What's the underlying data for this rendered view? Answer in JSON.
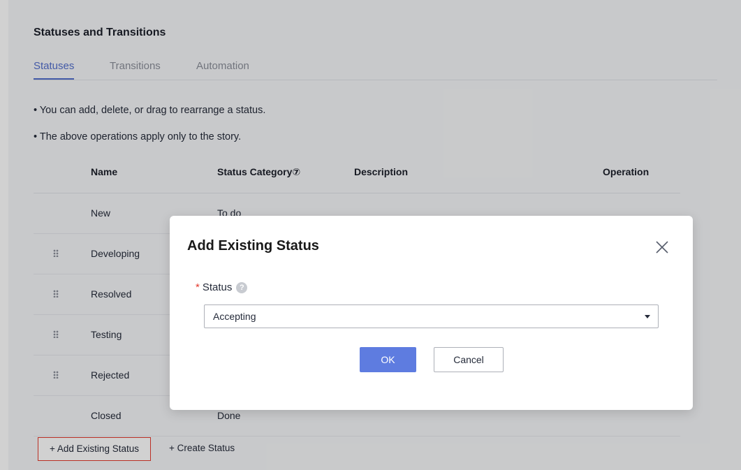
{
  "section": {
    "title": "Statuses and Transitions"
  },
  "tabs": [
    {
      "label": "Statuses",
      "active": true
    },
    {
      "label": "Transitions",
      "active": false
    },
    {
      "label": "Automation",
      "active": false
    }
  ],
  "notes": [
    "• You can add, delete, or drag to rearrange a status.",
    "• The above operations apply only to the story."
  ],
  "table": {
    "headers": {
      "name": "Name",
      "category": "Status Category⑦",
      "description": "Description",
      "operation": "Operation"
    },
    "rows": [
      {
        "name": "New",
        "category": "To do",
        "draggable": false
      },
      {
        "name": "Developing",
        "category": "",
        "draggable": true
      },
      {
        "name": "Resolved",
        "category": "",
        "draggable": true
      },
      {
        "name": "Testing",
        "category": "",
        "draggable": true
      },
      {
        "name": "Rejected",
        "category": "",
        "draggable": true
      },
      {
        "name": "Closed",
        "category": "Done",
        "draggable": false
      }
    ]
  },
  "actions": {
    "add_existing": "+ Add Existing Status",
    "create": "+ Create Status"
  },
  "dialog": {
    "title": "Add Existing Status",
    "field_label": "Status",
    "required_mark": "*",
    "help_glyph": "?",
    "selected_value": "Accepting",
    "ok_label": "OK",
    "cancel_label": "Cancel"
  },
  "colors": {
    "accent": "#526ecc",
    "primary_button": "#5e7ce0",
    "highlight_border": "#e33a2e"
  }
}
